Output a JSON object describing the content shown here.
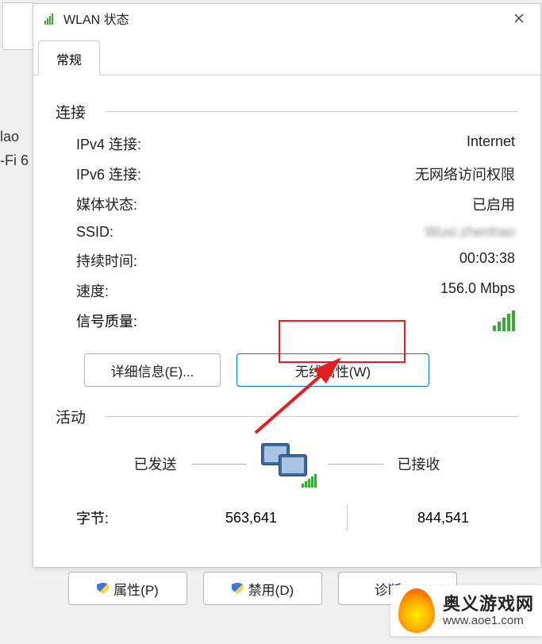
{
  "background": {
    "line1": "lao",
    "line2": "-Fi 6"
  },
  "dialog_title": "WLAN 状态",
  "tab_general": "常规",
  "section_connection": "连接",
  "connection": {
    "ipv4_label": "IPv4 连接:",
    "ipv4_value": "Internet",
    "ipv6_label": "IPv6 连接:",
    "ipv6_value": "无网络访问权限",
    "media_label": "媒体状态:",
    "media_value": "已启用",
    "ssid_label": "SSID:",
    "ssid_value": "Wuxi.zhenhao",
    "duration_label": "持续时间:",
    "duration_value": "00:03:38",
    "speed_label": "速度:",
    "speed_value": "156.0 Mbps",
    "signal_label": "信号质量:"
  },
  "buttons": {
    "details": "详细信息(E)...",
    "wireless_props": "无线属性(W)",
    "properties": "属性(P)",
    "disable": "禁用(D)",
    "diagnose": "诊断(G)"
  },
  "section_activity": "活动",
  "activity": {
    "sent_label": "已发送",
    "recv_label": "已接收",
    "bytes_label": "字节:",
    "bytes_sent": "563,641",
    "bytes_recv": "844,541"
  },
  "watermark": {
    "cn": "奥义游戏网",
    "en": "www.aoe1.com"
  }
}
